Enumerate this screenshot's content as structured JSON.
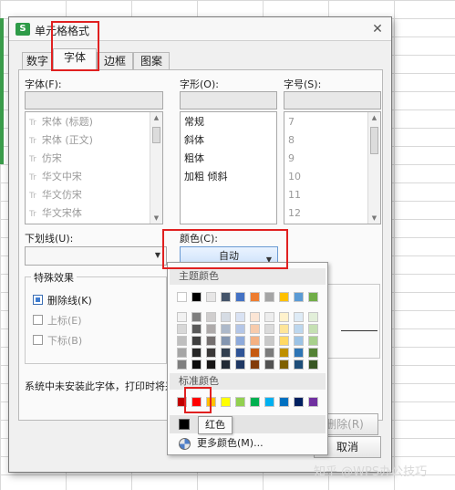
{
  "window": {
    "title": "单元格格式",
    "app_icon_letter": "S"
  },
  "tabs": [
    {
      "label": "数字",
      "active": false
    },
    {
      "label": "字体",
      "active": true
    },
    {
      "label": "边框",
      "active": false
    },
    {
      "label": "图案",
      "active": false
    }
  ],
  "font": {
    "label": "字体(F):",
    "value": "",
    "items": [
      "宋体 (标题)",
      "宋体 (正文)",
      "仿宋",
      "华文中宋",
      "华文仿宋",
      "华文宋体"
    ]
  },
  "style": {
    "label": "字形(O):",
    "value": "",
    "items": [
      "常规",
      "斜体",
      "粗体",
      "加粗 倾斜"
    ]
  },
  "size": {
    "label": "字号(S):",
    "value": "",
    "items": [
      "7",
      "8",
      "9",
      "10",
      "11",
      "12"
    ]
  },
  "underline": {
    "label": "下划线(U):",
    "value": ""
  },
  "color": {
    "label": "颜色(C):",
    "value": "自动"
  },
  "effects": {
    "title": "特殊效果",
    "strikethrough": {
      "label": "删除线(K)",
      "checked": true
    },
    "superscript": {
      "label": "上标(E)",
      "checked": false
    },
    "subscript": {
      "label": "下标(B)",
      "checked": false
    }
  },
  "notice": "系统中未安装此字体，打印时将采",
  "buttons": {
    "clear": "删除(R)",
    "cancel": "取消"
  },
  "palette": {
    "theme_header": "主题颜色",
    "theme_top": [
      "#ffffff",
      "#000000",
      "#e7e6e6",
      "#44546a",
      "#4472c4",
      "#ed7d31",
      "#a5a5a5",
      "#ffc000",
      "#5b9bd5",
      "#70ad47"
    ],
    "theme_shades": [
      [
        "#f2f2f2",
        "#7f7f7f",
        "#d0cece",
        "#d6dce4",
        "#d9e2f3",
        "#fbe5d5",
        "#ededed",
        "#fff2cc",
        "#deebf6",
        "#e2efd9"
      ],
      [
        "#d8d8d8",
        "#595959",
        "#aeaaaa",
        "#adb9ca",
        "#b4c6e7",
        "#f7cbac",
        "#dbdbdb",
        "#fee599",
        "#bdd7ee",
        "#c5e0b3"
      ],
      [
        "#bfbfbf",
        "#3f3f3f",
        "#757070",
        "#8496b0",
        "#8eaadb",
        "#f4b183",
        "#c9c9c9",
        "#ffd965",
        "#9cc3e5",
        "#a8d08d"
      ],
      [
        "#a5a5a5",
        "#262626",
        "#3a3838",
        "#323f4f",
        "#2f5496",
        "#c55a11",
        "#7b7b7b",
        "#bf9000",
        "#2e75b5",
        "#538135"
      ],
      [
        "#7f7f7f",
        "#0c0c0c",
        "#171616",
        "#222a35",
        "#1f3864",
        "#833c0b",
        "#525252",
        "#7f6000",
        "#1e4e79",
        "#375623"
      ]
    ],
    "standard_header": "标准颜色",
    "standard": [
      "#c00000",
      "#ff0000",
      "#ffc000",
      "#ffff00",
      "#92d050",
      "#00b050",
      "#00b0f0",
      "#0070c0",
      "#002060",
      "#7030a0"
    ],
    "recent_color": "#000000",
    "more_colors_label": "更多颜色(M)..."
  },
  "tooltip": "红色",
  "watermark": "知乎 @WPS办公技巧"
}
